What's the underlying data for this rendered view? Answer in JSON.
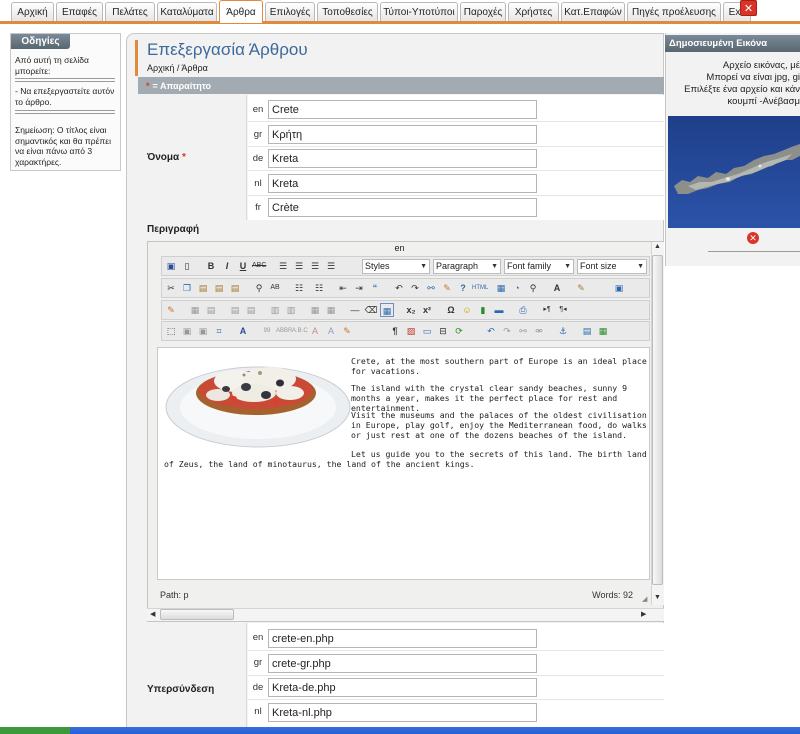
{
  "tabs": [
    "Αρχική",
    "Επαφές",
    "Πελάτες",
    "Καταλύματα",
    "Άρθρα",
    "Επιλογές",
    "Τοποθεσίες",
    "Τύποι-Υποτύποι",
    "Παροχές",
    "Χρήστες",
    "Κατ.Επαφών",
    "Πηγές προέλευσης",
    "Exit"
  ],
  "active_tab": "Άρθρα",
  "help": {
    "title": "Οδηγίες",
    "intro": "Από αυτή τη σελίδα μπορείτε:",
    "item": "- Να επεξεργαστείτε αυτόν το άρθρο.",
    "note": "Σημείωση: Ο τίτλος είναι σημαντικός και θα πρέπει να είναι πάνω από 3 χαρακτήρες."
  },
  "page": {
    "title": "Επεξεργασία Άρθρου",
    "breadcrumb": "Αρχική / Άρθρα",
    "required_star": "*",
    "required_text": "= Απαραίτητο"
  },
  "name_field": {
    "label": "Όνομα",
    "star": "*",
    "rows": [
      {
        "lang": "en",
        "value": "Crete"
      },
      {
        "lang": "gr",
        "value": "Κρήτη"
      },
      {
        "lang": "de",
        "value": "Kreta"
      },
      {
        "lang": "nl",
        "value": "Kreta"
      },
      {
        "lang": "fr",
        "value": "Crète"
      }
    ]
  },
  "description": {
    "label": "Περιγραφή",
    "editor_lang": "en",
    "styles": "Styles",
    "paragraph": "Paragraph",
    "font_family": "Font family",
    "font_size": "Font size",
    "paragraphs": [
      "Crete, at the most southern part of Europe is an ideal place for vacations.",
      "The island with the crystal clear sandy beaches, sunny 9 months a year, makes it the perfect place for rest and entertainment.",
      "Visit the museums and the palaces of the oldest civilisation in Europe, play golf, enjoy the Mediterranean food, do walks or just rest at one of the dozens beaches of the island.",
      "Let us guide you to the secrets of this land. The birth land of Zeus, the land of minotaurus, the land of the ancient kings."
    ],
    "path": "Path: p",
    "words": "Words: 92"
  },
  "link_field": {
    "label": "Υπερσύνδεση",
    "rows": [
      {
        "lang": "en",
        "value": "crete-en.php"
      },
      {
        "lang": "gr",
        "value": "crete-gr.php"
      },
      {
        "lang": "de",
        "value": "Kreta-de.php"
      },
      {
        "lang": "nl",
        "value": "Kreta-nl.php"
      }
    ]
  },
  "image_panel": {
    "title": "Δημοσιευμένη Εικόνα",
    "lines": [
      "Αρχείο εικόνας, μέ",
      "Μπορεί να είναι jpg, gi",
      "Επιλέξτε ένα αρχείο και κάν",
      "κουμπί -Ανέβασμ"
    ]
  },
  "colors": {
    "accent": "#e08a3c",
    "title_blue": "#3b6a9b",
    "required_bar": "#a3abb2",
    "delete_red": "#d9342a"
  }
}
